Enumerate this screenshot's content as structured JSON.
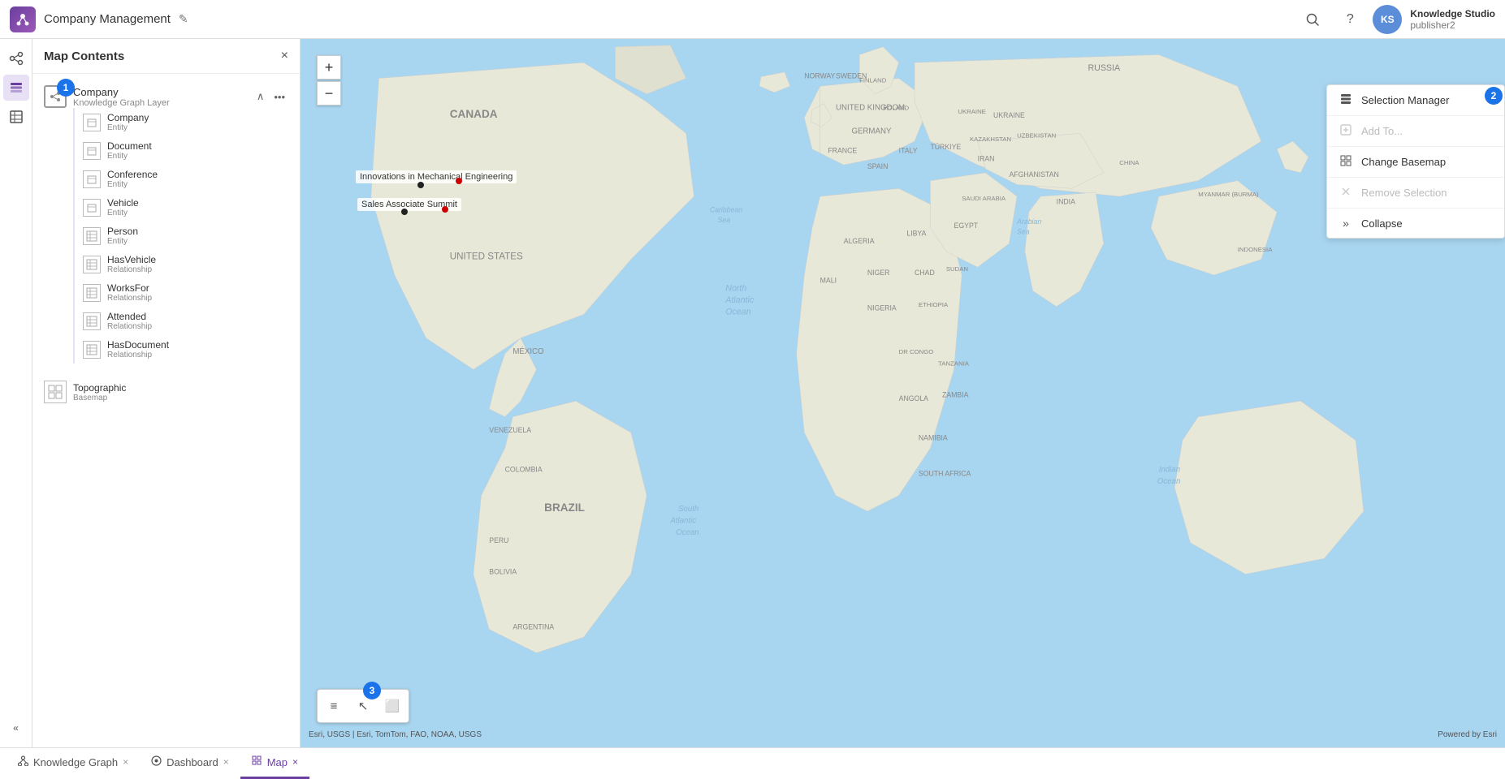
{
  "header": {
    "title": "Company Management",
    "edit_tooltip": "Edit",
    "search_tooltip": "Search",
    "help_tooltip": "Help",
    "avatar_initials": "KS",
    "user_name": "Knowledge Studio",
    "user_role": "publisher2"
  },
  "map_contents": {
    "title": "Map Contents",
    "close_label": "×",
    "layer_group": {
      "name": "Company",
      "subtitle": "Knowledge Graph Layer",
      "badge": "1",
      "items": [
        {
          "name": "Company",
          "type": "Entity",
          "has_eye": true
        },
        {
          "name": "Document",
          "type": "Entity",
          "has_eye": true
        },
        {
          "name": "Conference",
          "type": "Entity",
          "has_eye": true
        },
        {
          "name": "Vehicle",
          "type": "Entity",
          "has_eye": false
        },
        {
          "name": "Person",
          "type": "Entity",
          "has_eye": false
        },
        {
          "name": "HasVehicle",
          "type": "Relationship",
          "has_eye": false
        },
        {
          "name": "WorksFor",
          "type": "Relationship",
          "has_eye": false
        },
        {
          "name": "Attended",
          "type": "Relationship",
          "has_eye": false
        },
        {
          "name": "HasDocument",
          "type": "Relationship",
          "has_eye": false
        }
      ]
    },
    "basemap": {
      "name": "Topographic",
      "type": "Basemap"
    }
  },
  "map": {
    "label1": "Innovations in Mechanical Engineering",
    "label2": "Sales Associate Summit",
    "attribution_left": "Esri, USGS | Esri, TomTom, FAO, NOAA, USGS",
    "attribution_right": "Powered by Esri"
  },
  "right_panel": {
    "items": [
      {
        "label": "Selection Manager",
        "icon": "☰",
        "disabled": false
      },
      {
        "label": "Add To...",
        "icon": "⊕",
        "disabled": true
      },
      {
        "label": "Change Basemap",
        "icon": "⊞",
        "disabled": false
      },
      {
        "label": "Remove Selection",
        "icon": "✕",
        "disabled": true
      },
      {
        "label": "Collapse",
        "icon": "»",
        "disabled": false
      }
    ],
    "badge": "2"
  },
  "toolbar": {
    "badge": "3",
    "buttons": [
      "≡",
      "↖",
      "⬜"
    ]
  },
  "bottom_tabs": [
    {
      "label": "Knowledge Graph",
      "icon": "◈",
      "active": false,
      "closeable": true
    },
    {
      "label": "Dashboard",
      "icon": "◉",
      "active": false,
      "closeable": true
    },
    {
      "label": "Map",
      "icon": "⊞",
      "active": true,
      "closeable": true
    }
  ]
}
